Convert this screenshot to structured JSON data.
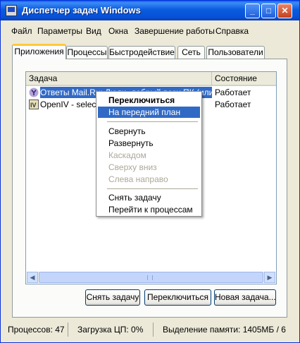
{
  "window": {
    "title": "Диспетчер задач Windows"
  },
  "colors": {
    "titlebar": "#0a5ce0",
    "selection": "#316ac5",
    "active_tab_accent": "#ffc83c"
  },
  "menu": [
    "Файл",
    "Параметры",
    "Вид",
    "Окна",
    "Завершение работы",
    "Справка"
  ],
  "tabs": [
    {
      "label": "Приложения",
      "active": true
    },
    {
      "label": "Процессы"
    },
    {
      "label": "Быстродействие"
    },
    {
      "label": "Сеть"
    },
    {
      "label": "Пользователи"
    }
  ],
  "list": {
    "columns": [
      "Задача",
      "Состояние"
    ],
    "rows": [
      {
        "task": "Ответы Mail.Ru: Люди, добрый всех ПК (или...",
        "status": "Работает",
        "icon": "mail-ru-answers-icon",
        "selected": true
      },
      {
        "task": "OpenIV - select",
        "status": "Работает",
        "icon": "openiv-icon",
        "selected": false
      }
    ]
  },
  "context_menu": {
    "items": [
      {
        "label": "Переключиться",
        "bold": true
      },
      {
        "label": "На передний план",
        "highlighted": true
      },
      {
        "label": "Свернуть"
      },
      {
        "label": "Развернуть"
      },
      {
        "label": "Каскадом",
        "disabled": true
      },
      {
        "label": "Сверху вниз",
        "disabled": true
      },
      {
        "label": "Слева направо",
        "disabled": true
      },
      {
        "label": "Снять задачу"
      },
      {
        "label": "Перейти к процессам"
      }
    ]
  },
  "buttons": {
    "end_task": "Снять задачу",
    "switch_to": "Переключиться",
    "new_task": "Новая задача..."
  },
  "statusbar": {
    "processes": "Процессов: 47",
    "cpu": "Загрузка ЦП: 0%",
    "commit": "Выделение памяти: 1405МБ / 6"
  }
}
